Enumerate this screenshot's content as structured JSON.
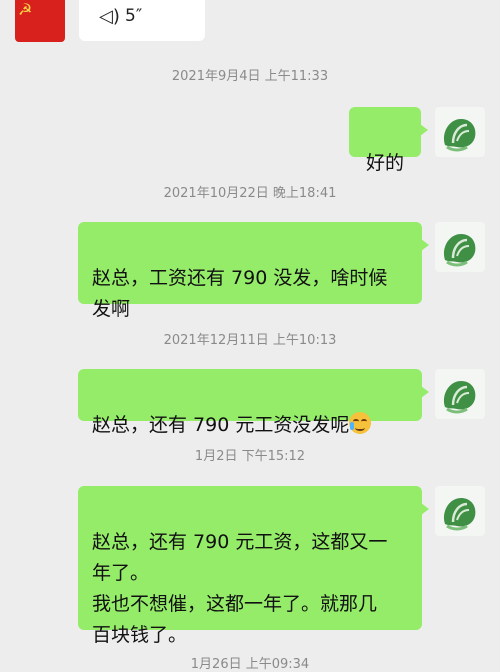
{
  "top_voice": {
    "duration": "5″"
  },
  "messages": [
    {
      "timestamp": "2021年9月4日 上午11:33",
      "text": "好的"
    },
    {
      "timestamp": "2021年10月22日 晚上18:41",
      "text": "赵总，工资还有 790 没发，啥时候\n发啊"
    },
    {
      "timestamp": "2021年12月11日 上午10:13",
      "text": "赵总，还有 790 元工资没发呢",
      "emoji": "crying-laughing-emoji"
    },
    {
      "timestamp": "1月2日 下午15:12",
      "text": "赵总，还有 790 元工资，这都又一\n年了。\n我也不想催，这都一年了。就那几\n百块钱了。"
    },
    {
      "timestamp": "1月26日 上午09:34"
    }
  ],
  "colors": {
    "bubble_green": "#95ec69",
    "background": "#ededed",
    "avatar_red": "#d8201c"
  }
}
